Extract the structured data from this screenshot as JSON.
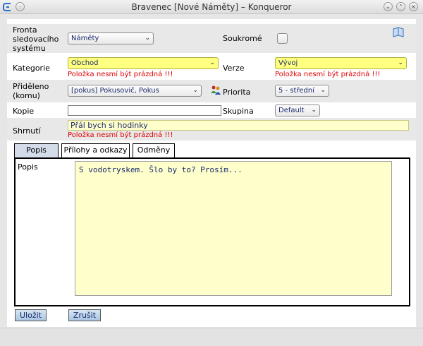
{
  "window": {
    "title": "Bravenec [Nové Náměty] – Konqueror",
    "icons": [
      "konqueror-icon",
      "pin-icon",
      "minimize-icon",
      "maximize-icon",
      "close-icon"
    ]
  },
  "form": {
    "tracker": {
      "label": "Fronta sledovacího systému",
      "value": "Náměty"
    },
    "private": {
      "label": "Soukromé",
      "checked": false
    },
    "category": {
      "label": "Kategorie",
      "value": "Obchod",
      "error": "Položka nesmí být prázdná !!!"
    },
    "version": {
      "label": "Verze",
      "value": "Vývoj",
      "error": "Položka nesmí být prázdná !!!"
    },
    "assigned": {
      "label": "Přiděleno (komu)",
      "value": "[pokus] Pokusovič, Pokus"
    },
    "priority": {
      "label": "Priorita",
      "value": "5 - střední"
    },
    "copy": {
      "label": "Kopie",
      "value": ""
    },
    "group": {
      "label": "Skupina",
      "value": "Default"
    },
    "summary": {
      "label": "Shrnutí",
      "value": "Přál bych si hodinky",
      "error": "Položka nesmí být prázdná !!!"
    }
  },
  "tabs": [
    {
      "label": "Popis",
      "active": true
    },
    {
      "label": "Přílohy a odkazy",
      "active": false
    },
    {
      "label": "Odměny",
      "active": false
    }
  ],
  "description": {
    "label": "Popis",
    "value": "S vodotryskem. Šlo by to? Prosím..."
  },
  "buttons": {
    "save": "Uložit",
    "cancel": "Zrušit"
  },
  "colors": {
    "required_field": "#ffff80",
    "error_text": "#e00000",
    "button": "#b8d0e8",
    "active_tab": "#d4dcea"
  }
}
